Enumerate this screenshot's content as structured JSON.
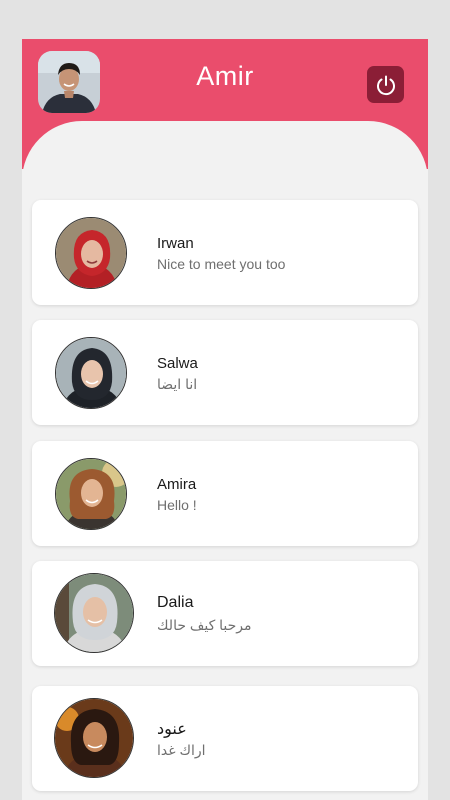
{
  "header": {
    "title": "Amir",
    "profile_icon": "user-avatar",
    "logout_icon": "power-icon"
  },
  "colors": {
    "header": "#ea4d6c",
    "logout_button": "#8b1e36",
    "background": "#f2f2f2",
    "card": "#ffffff"
  },
  "chats": [
    {
      "name": "Irwan",
      "last_message": "Nice to meet you too"
    },
    {
      "name": "Salwa",
      "last_message": "انا ايضا"
    },
    {
      "name": "Amira",
      "last_message": "Hello !"
    },
    {
      "name": "Dalia",
      "last_message": "مرحبا كيف حالك"
    },
    {
      "name": "عنود",
      "last_message": "اراك غدا"
    }
  ]
}
